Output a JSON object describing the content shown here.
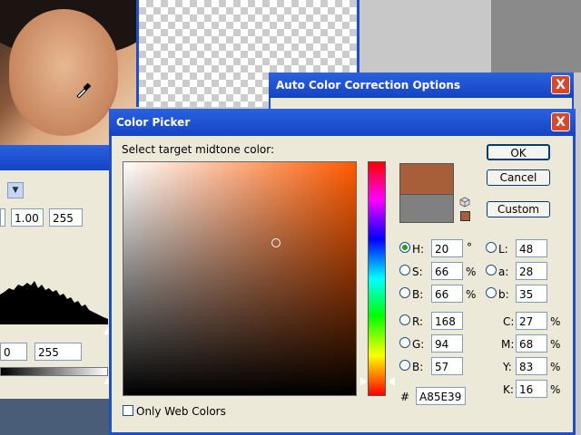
{
  "auto_color_window": {
    "title": "Auto Color Correction Options",
    "close_label": "X"
  },
  "levels_window": {
    "field_values": [
      "1.00",
      "255"
    ],
    "output_values": [
      "0",
      "255"
    ]
  },
  "color_picker": {
    "title": "Color Picker",
    "close_label": "X",
    "prompt": "Select target midtone color:",
    "buttons": {
      "ok": "OK",
      "cancel": "Cancel",
      "custom": "Custom"
    },
    "hsb": {
      "h": {
        "label": "H:",
        "value": "20",
        "unit": "°"
      },
      "s": {
        "label": "S:",
        "value": "66",
        "unit": "%"
      },
      "b": {
        "label": "B:",
        "value": "66",
        "unit": "%"
      }
    },
    "lab": {
      "l": {
        "label": "L:",
        "value": "48"
      },
      "a": {
        "label": "a:",
        "value": "28"
      },
      "b": {
        "label": "b:",
        "value": "35"
      }
    },
    "rgb": {
      "r": {
        "label": "R:",
        "value": "168"
      },
      "g": {
        "label": "G:",
        "value": "94"
      },
      "b": {
        "label": "B:",
        "value": "57"
      }
    },
    "cmyk": {
      "c": {
        "label": "C:",
        "value": "27",
        "unit": "%"
      },
      "m": {
        "label": "M:",
        "value": "68",
        "unit": "%"
      },
      "y": {
        "label": "Y:",
        "value": "83",
        "unit": "%"
      },
      "k": {
        "label": "K:",
        "value": "16",
        "unit": "%"
      }
    },
    "hex": {
      "label": "#",
      "value": "A85E39"
    },
    "only_web_colors": "Only Web Colors",
    "selected_color": "#a85e39",
    "original_color": "#808080"
  }
}
